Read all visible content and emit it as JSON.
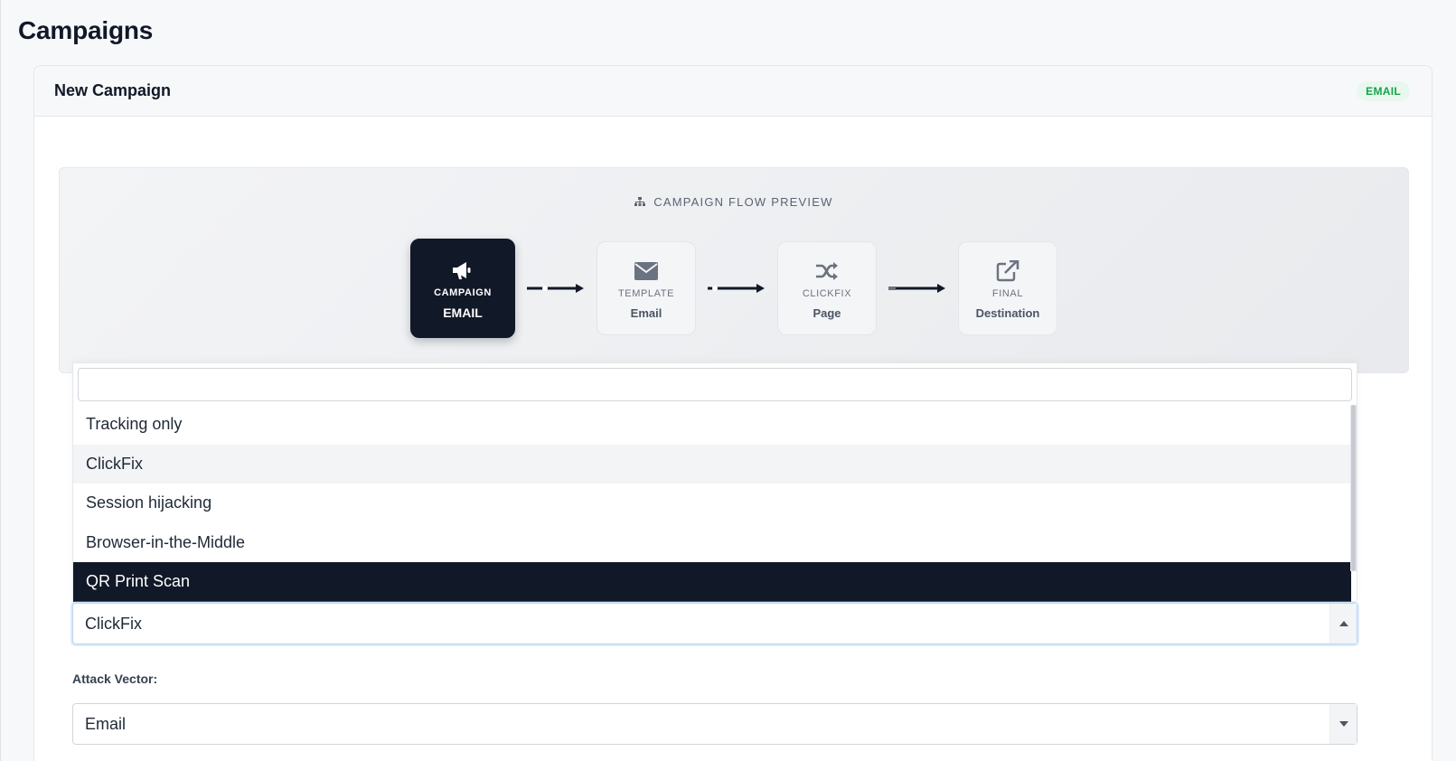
{
  "page": {
    "title": "Campaigns"
  },
  "card": {
    "title": "New Campaign",
    "badge": "EMAIL",
    "badge_color": "#16a34a"
  },
  "flow": {
    "title": "CAMPAIGN FLOW PREVIEW",
    "nodes": [
      {
        "label": "CAMPAIGN",
        "value": "EMAIL",
        "icon": "megaphone-icon",
        "active": true
      },
      {
        "label": "TEMPLATE",
        "value": "Email",
        "icon": "envelope-icon",
        "active": false
      },
      {
        "label": "CLICKFIX",
        "value": "Page",
        "icon": "shuffle-icon",
        "active": false
      },
      {
        "label": "FINAL",
        "value": "Destination",
        "icon": "external-link-icon",
        "active": false
      }
    ]
  },
  "dropdown": {
    "search_value": "",
    "options": [
      {
        "label": "Tracking only",
        "state": "normal"
      },
      {
        "label": "ClickFix",
        "state": "hover"
      },
      {
        "label": "Session hijacking",
        "state": "normal"
      },
      {
        "label": "Browser-in-the-Middle",
        "state": "normal"
      },
      {
        "label": "QR Print Scan",
        "state": "selected"
      }
    ]
  },
  "payload_select": {
    "value": "ClickFix",
    "caret": "caret-up-icon"
  },
  "attack_vector": {
    "label": "Attack Vector:",
    "value": "Email",
    "caret": "caret-down-icon"
  },
  "colors": {
    "dark": "#111827",
    "accent_green": "#16a34a",
    "hover_bg": "#f3f4f6"
  }
}
